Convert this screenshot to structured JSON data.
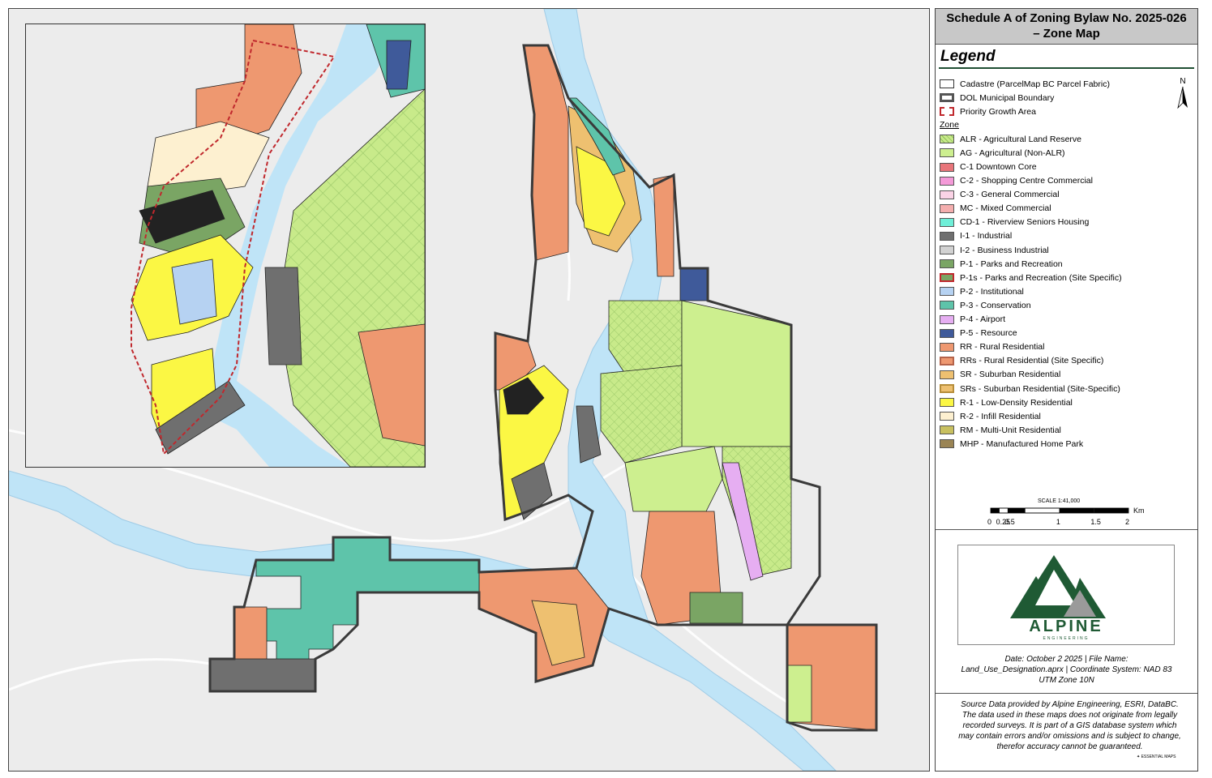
{
  "title": {
    "line1": "Schedule A of Zoning Bylaw No. 2025-026",
    "line2": "– Zone Map"
  },
  "legend": {
    "heading": "Legend",
    "zone_heading": "Zone",
    "north_label": "N",
    "boundaries": [
      {
        "label": "Cadastre (ParcelMap BC Parcel Fabric)",
        "fill": "#ffffff",
        "stroke": "#333333",
        "style": "solid"
      },
      {
        "label": "DOL Municipal Boundary",
        "fill": "#ffffff",
        "stroke": "#555555",
        "style": "thick"
      },
      {
        "label": "Priority Growth Area",
        "fill": "#ffffff",
        "stroke": "#c0282d",
        "style": "dashed"
      }
    ],
    "zones": [
      {
        "label": "ALR - Agricultural Land Reserve",
        "color": "#c8ea8a",
        "pattern": "hatch"
      },
      {
        "label": "AG - Agricultural (Non-ALR)",
        "color": "#cdef8f"
      },
      {
        "label": "C-1 Downtown Core",
        "color": "#e8757a"
      },
      {
        "label": "C-2 - Shopping Centre Commercial",
        "color": "#f49ad8"
      },
      {
        "label": "C-3 - General Commercial",
        "color": "#fbd3e6"
      },
      {
        "label": "MC - Mixed Commercial",
        "color": "#f4aeae"
      },
      {
        "label": "CD-1 - Riverview Seniors Housing",
        "color": "#6fefd8"
      },
      {
        "label": "I-1 - Industrial",
        "color": "#6f6f6f"
      },
      {
        "label": "I-2 - Business Industrial",
        "color": "#d2d2d2"
      },
      {
        "label": "P-1 - Parks and Recreation",
        "color": "#7aa564"
      },
      {
        "label": "P-1s - Parks and Recreation (Site Specific)",
        "color": "#7aa564",
        "stroke": "#c0282d"
      },
      {
        "label": "P-2 - Institutional",
        "color": "#b6d2f2"
      },
      {
        "label": "P-3 - Conservation",
        "color": "#5ec4aa"
      },
      {
        "label": "P-4 - Airport",
        "color": "#e6aef2"
      },
      {
        "label": "P-5 - Resource",
        "color": "#3f5a9a"
      },
      {
        "label": "RR - Rural Residential",
        "color": "#ee9870"
      },
      {
        "label": "RRs - Rural Residential (Site Specific)",
        "color": "#ee9870",
        "stroke": "#b5634a"
      },
      {
        "label": "SR - Suburban Residential",
        "color": "#eec070"
      },
      {
        "label": "SRs - Suburban Residential (Site-Specific)",
        "color": "#eec070",
        "stroke": "#b68d3a"
      },
      {
        "label": "R-1 - Low-Density Residential",
        "color": "#fbf744"
      },
      {
        "label": "R-2 - Infill Residential",
        "color": "#fdf0d0"
      },
      {
        "label": "RM - Multi-Unit Residential",
        "color": "#c8c060"
      },
      {
        "label": "MHP - Manufactured Home Park",
        "color": "#9a8454"
      }
    ]
  },
  "scale": {
    "title": "SCALE 1:41,000",
    "unit": "Km",
    "ticks": [
      "0",
      "0.25",
      "0.5",
      "1",
      "1.5",
      "2"
    ]
  },
  "logo": {
    "name": "ALPINE",
    "tagline": "ENGINEERING"
  },
  "metadata": {
    "line1": "Date: October 2 2025 | File Name:",
    "line2": "Land_Use_Designation.aprx | Coordinate System: NAD 83",
    "line3": "UTM Zone 10N"
  },
  "source": {
    "line1": "Source Data provided by Alpine Engineering, ESRI, DataBC.",
    "line2": "The data used in these maps does not originate from legally",
    "line3": "recorded surveys. It is part of a GIS database system which",
    "line4": "may contain errors and/or omissions and is subject to change,",
    "line5": "therefor accuracy cannot be guaranteed."
  },
  "credit": {
    "text": "ESSENTIAL MAPS"
  },
  "colors": {
    "water": "#bfe4f7",
    "background": "#ececec",
    "alpine_green": "#1f5a34"
  }
}
